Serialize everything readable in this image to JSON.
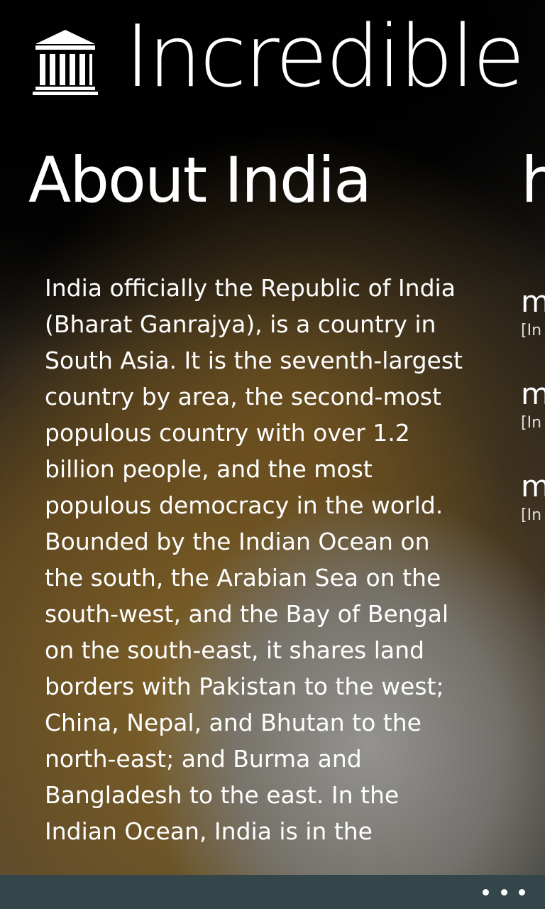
{
  "header": {
    "app_title": "Incredible",
    "icon": "temple-building-icon"
  },
  "sections": {
    "about": {
      "title": "About India",
      "body": "India officially the Republic of India (Bharat Ganrajya), is a country in South Asia. It is the seventh-largest country by area, the second-most populous country with over 1.2 billion people, and the most populous democracy in the world. Bounded by the Indian Ocean on the south, the Arabian Sea on the south-west, and the Bay of Bengal on the south-east, it shares land borders with Pakistan to the west; China, Nepal, and Bhutan to the north-east; and Burma and Bangladesh to the east. In the Indian Ocean, India is in the"
    },
    "next": {
      "title_partial": "h",
      "items": [
        {
          "title": "m",
          "subtitle": "[In"
        },
        {
          "title": "m",
          "subtitle": "[In"
        },
        {
          "title": "m",
          "subtitle": "[In"
        }
      ]
    }
  },
  "app_bar": {
    "more_icon": "ellipsis-icon"
  },
  "colors": {
    "app_bar_bg": "#34464a",
    "text": "#ffffff"
  }
}
